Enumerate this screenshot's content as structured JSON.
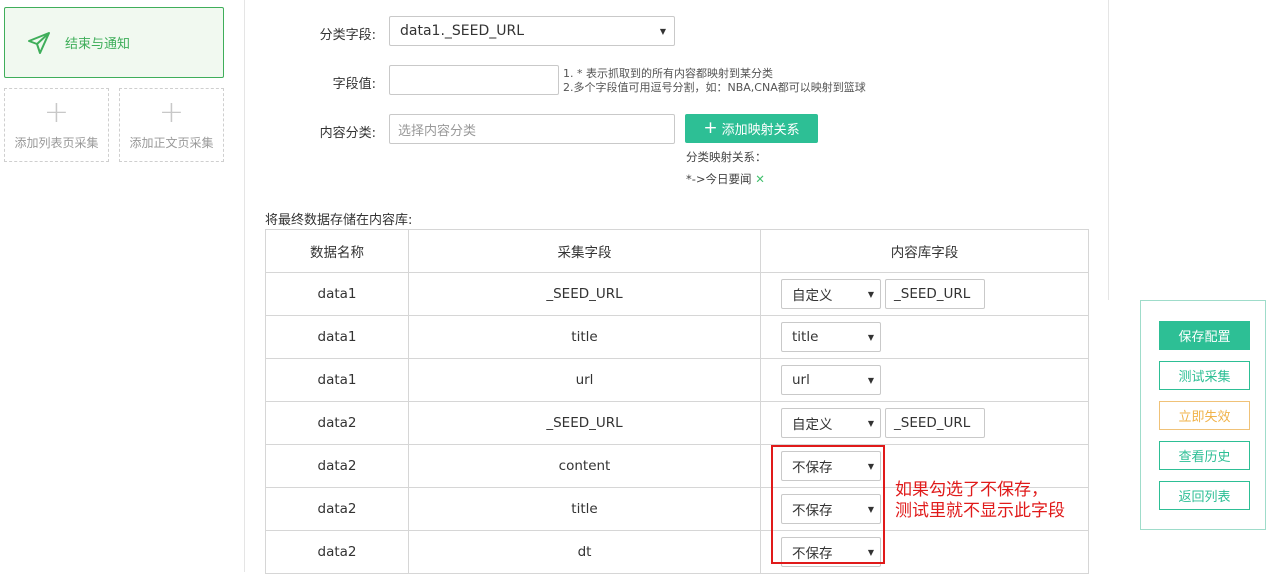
{
  "sidebar": {
    "finish_label": "结束与通知",
    "add_list_label": "添加列表页采集",
    "add_content_label": "添加正文页采集"
  },
  "form": {
    "category_field_label": "分类字段:",
    "category_field_value": "data1._SEED_URL",
    "field_value_label": "字段值:",
    "field_value_value": "",
    "hint_line1": "1. * 表示抓取到的所有内容都映射到某分类",
    "hint_line2": "2.多个字段值可用逗号分割，如：NBA,CNA都可以映射到篮球",
    "content_category_label": "内容分类:",
    "content_category_placeholder": "选择内容分类",
    "add_mapping_button": "添加映射关系",
    "mapping_title": "分类映射关系：",
    "mapping_item": "*->今日要闻",
    "store_label": "将最终数据存储在内容库:"
  },
  "table": {
    "headers": [
      "数据名称",
      "采集字段",
      "内容库字段"
    ],
    "rows": [
      {
        "name": "data1",
        "field": "_SEED_URL",
        "select": "自定义",
        "custom": "_SEED_URL"
      },
      {
        "name": "data1",
        "field": "title",
        "select": "title",
        "custom": null
      },
      {
        "name": "data1",
        "field": "url",
        "select": "url",
        "custom": null
      },
      {
        "name": "data2",
        "field": "_SEED_URL",
        "select": "自定义",
        "custom": "_SEED_URL"
      },
      {
        "name": "data2",
        "field": "content",
        "select": "不保存",
        "custom": null
      },
      {
        "name": "data2",
        "field": "title",
        "select": "不保存",
        "custom": null
      },
      {
        "name": "data2",
        "field": "dt",
        "select": "不保存",
        "custom": null
      }
    ]
  },
  "annotation": {
    "line1": "如果勾选了不保存，",
    "line2": "测试里就不显示此字段",
    "color": "#e01a1a"
  },
  "actions": {
    "save": "保存配置",
    "test": "测试采集",
    "disable": "立即失效",
    "history": "查看历史",
    "back": "返回列表"
  },
  "colors": {
    "accent": "#2dbf95",
    "finish_green": "#3fae5a",
    "warn": "#f0b34a"
  }
}
